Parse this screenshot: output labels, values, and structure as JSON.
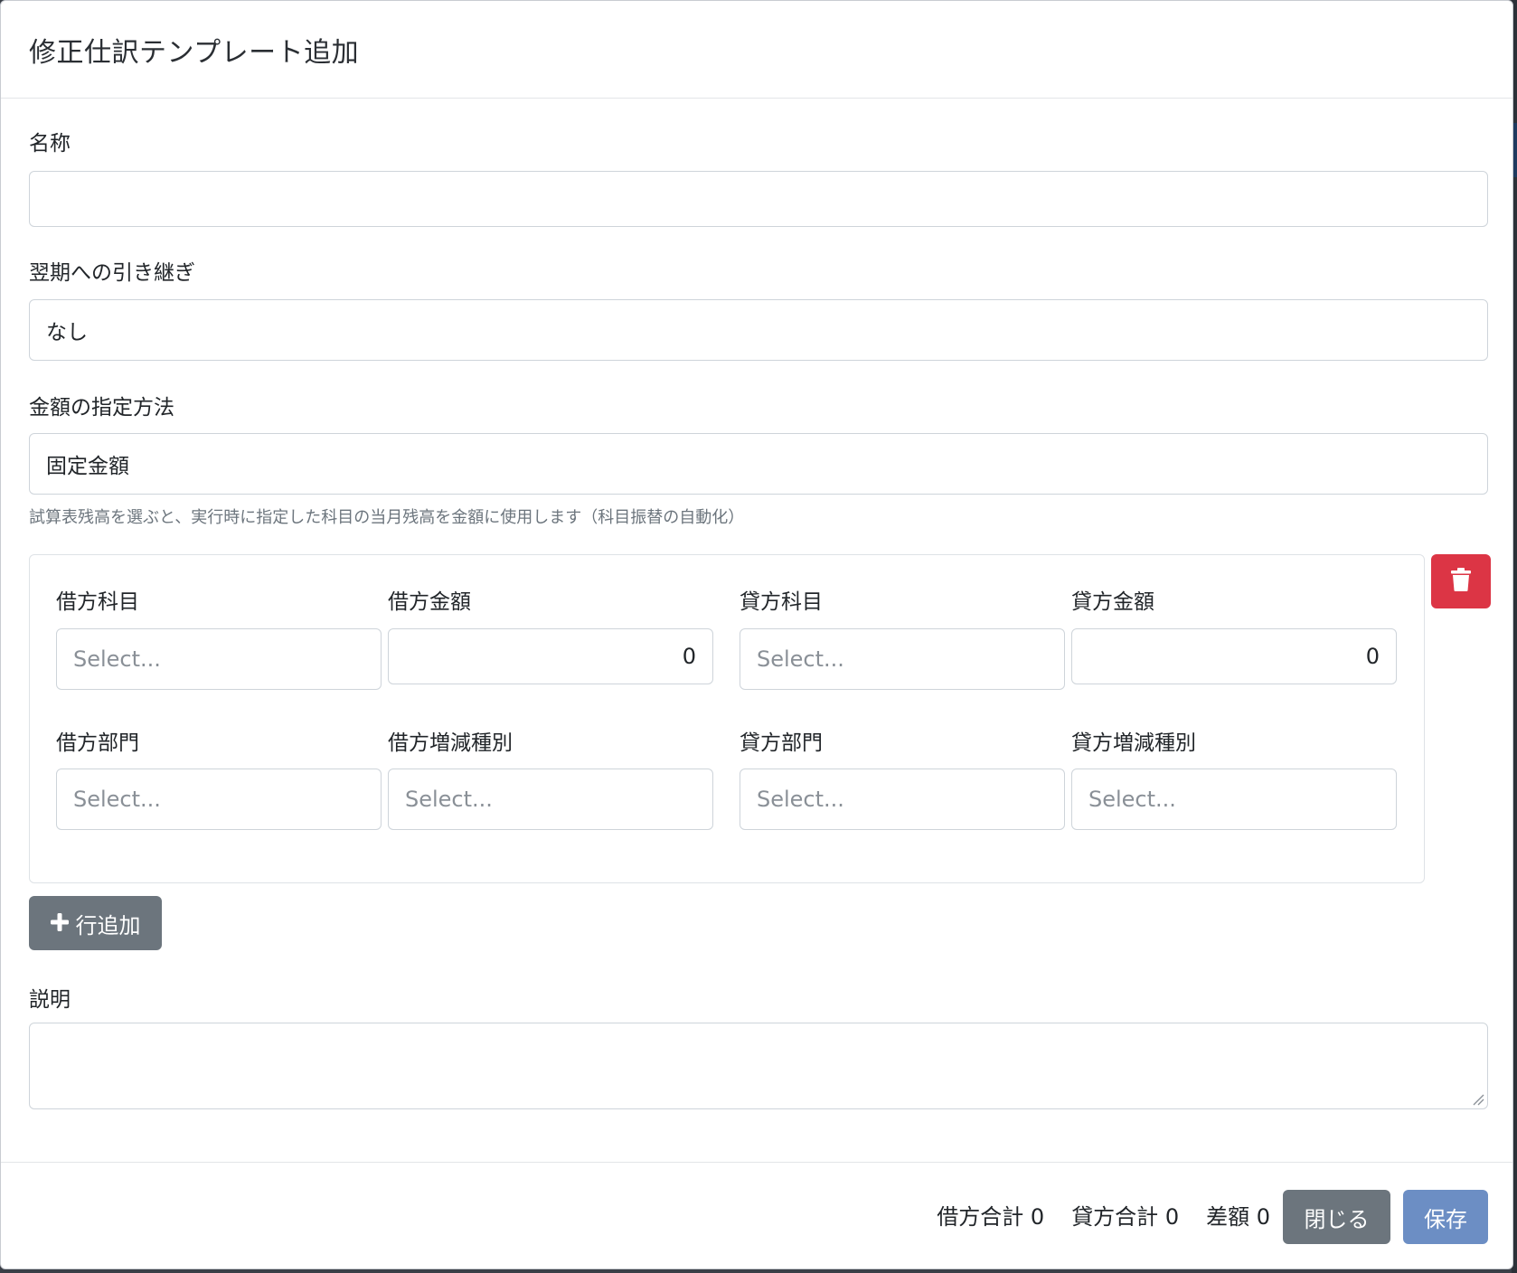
{
  "modal": {
    "title": "修正仕訳テンプレート追加"
  },
  "form": {
    "name_label": "名称",
    "name_value": "",
    "carryover_label": "翌期への引き継ぎ",
    "carryover_value": "なし",
    "amount_method_label": "金額の指定方法",
    "amount_method_value": "固定金額",
    "amount_method_hint": "試算表残高を選ぶと、実行時に指定した科目の当月残高を金額に使用します（科目振替の自動化）",
    "description_label": "説明",
    "description_value": ""
  },
  "line": {
    "debit_account_label": "借方科目",
    "debit_account_placeholder": "Select...",
    "debit_amount_label": "借方金額",
    "debit_amount_value": "0",
    "credit_account_label": "貸方科目",
    "credit_account_placeholder": "Select...",
    "credit_amount_label": "貸方金額",
    "credit_amount_value": "0",
    "debit_department_label": "借方部門",
    "debit_department_placeholder": "Select...",
    "debit_change_type_label": "借方増減種別",
    "debit_change_type_placeholder": "Select...",
    "credit_department_label": "貸方部門",
    "credit_department_placeholder": "Select...",
    "credit_change_type_label": "貸方増減種別",
    "credit_change_type_placeholder": "Select..."
  },
  "buttons": {
    "add_row_label": "行追加",
    "close_label": "閉じる",
    "save_label": "保存"
  },
  "totals": {
    "debit_total": "借方合計 0",
    "credit_total": "貸方合計 0",
    "difference": "差額 0"
  },
  "icons": {
    "delete": "trash-icon",
    "add": "plus-icon"
  },
  "colors": {
    "danger": "#dc3545",
    "secondary": "#6c757d",
    "primary_disabled": "#6c8ec4"
  }
}
